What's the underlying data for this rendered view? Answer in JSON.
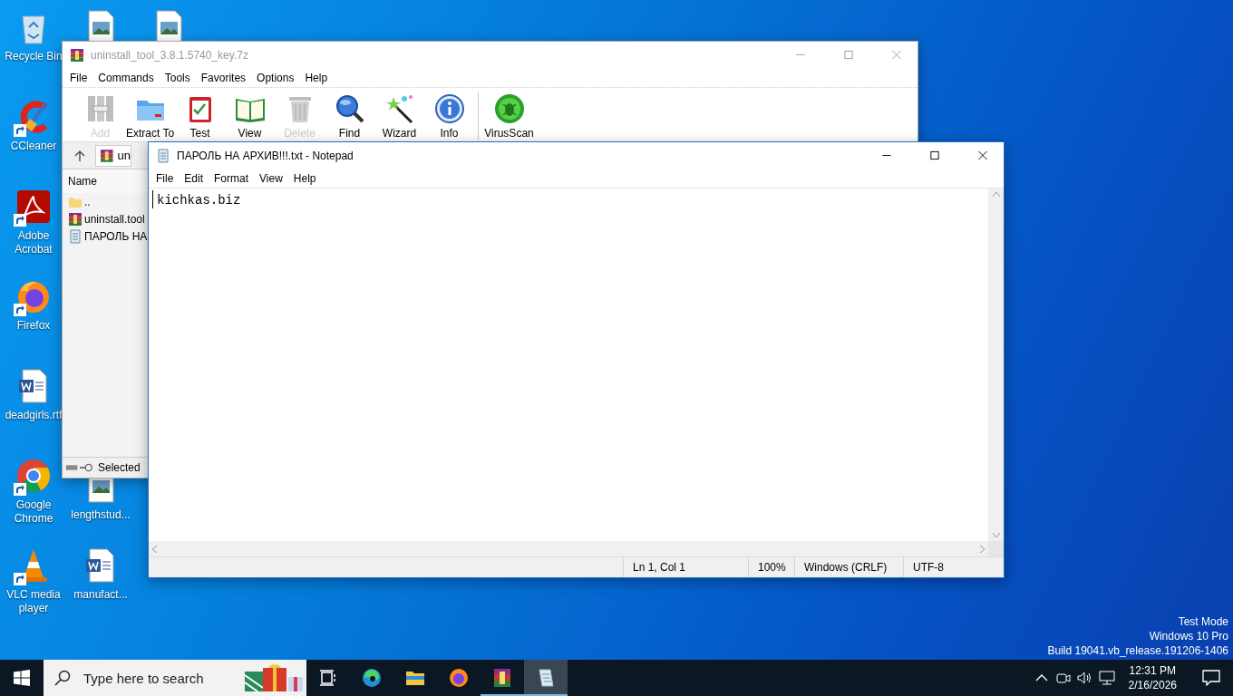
{
  "desktop": {
    "icons": [
      {
        "kind": "recycle",
        "label": "Recycle Bin",
        "shortcut": false
      },
      {
        "kind": "ccleaner",
        "label": "CCleaner",
        "shortcut": true
      },
      {
        "kind": "acrobat",
        "label": "Adobe Acrobat",
        "shortcut": true
      },
      {
        "kind": "firefox",
        "label": "Firefox",
        "shortcut": true
      },
      {
        "kind": "word",
        "label": "deadgirls.rtf",
        "shortcut": false
      },
      {
        "kind": "chrome",
        "label": "Google Chrome",
        "shortcut": true
      },
      {
        "kind": "vlc",
        "label": "VLC media player",
        "shortcut": true
      },
      {
        "kind": "image",
        "shortcut": false
      },
      {
        "kind": "image",
        "label": "lengthstud...",
        "shortcut": false
      },
      {
        "kind": "word",
        "label": "manufact...",
        "shortcut": false
      },
      {
        "kind": "image",
        "shortcut": false
      }
    ]
  },
  "winrar": {
    "title": "uninstall_tool_3.8.1.5740_key.7z",
    "menu": [
      "File",
      "Commands",
      "Tools",
      "Favorites",
      "Options",
      "Help"
    ],
    "toolbar": {
      "groups": [
        [
          {
            "kind": "add",
            "label": "Add",
            "disabled": true
          },
          {
            "kind": "extract",
            "label": "Extract To",
            "disabled": false
          },
          {
            "kind": "test",
            "label": "Test",
            "disabled": false
          },
          {
            "kind": "view",
            "label": "View",
            "disabled": false
          },
          {
            "kind": "delete",
            "label": "Delete",
            "disabled": true
          },
          {
            "kind": "find",
            "label": "Find",
            "disabled": false
          },
          {
            "kind": "wizard",
            "label": "Wizard",
            "disabled": false
          },
          {
            "kind": "info",
            "label": "Info",
            "disabled": false
          }
        ],
        [
          {
            "kind": "virus",
            "label": "VirusScan",
            "disabled": false
          }
        ]
      ]
    },
    "address": "un",
    "list": {
      "header": "Name",
      "rows": [
        {
          "kind": "folder",
          "name": ".."
        },
        {
          "kind": "archive",
          "name": "uninstall.tool"
        },
        {
          "kind": "text",
          "name": "ПАРОЛЬ НА"
        }
      ]
    },
    "status": "Selected"
  },
  "notepad": {
    "title": "ПАРОЛЬ НА АРХИВ!!!.txt - Notepad",
    "menu": [
      "File",
      "Edit",
      "Format",
      "View",
      "Help"
    ],
    "content": "kichkas.biz",
    "status_bar": [
      "Ln 1, Col 1",
      "100%",
      "Windows (CRLF)",
      "UTF-8"
    ]
  },
  "system_info": [
    "Test Mode",
    "Windows 10 Pro",
    "Build 19041.vb_release.191206-1406"
  ],
  "taskbar": {
    "search": {
      "placeholder": "Type here to search"
    },
    "apps": [
      {
        "kind": "taskview",
        "running": false,
        "selected": false
      },
      {
        "kind": "edge",
        "running": false,
        "selected": false
      },
      {
        "kind": "explorer",
        "running": false,
        "selected": false
      },
      {
        "kind": "firefox",
        "running": false,
        "selected": false
      },
      {
        "kind": "winrar",
        "running": true,
        "selected": false
      },
      {
        "kind": "notepad",
        "running": true,
        "selected": true
      }
    ],
    "clock": {
      "time": "12:31 PM",
      "date": "2/16/2026"
    }
  }
}
